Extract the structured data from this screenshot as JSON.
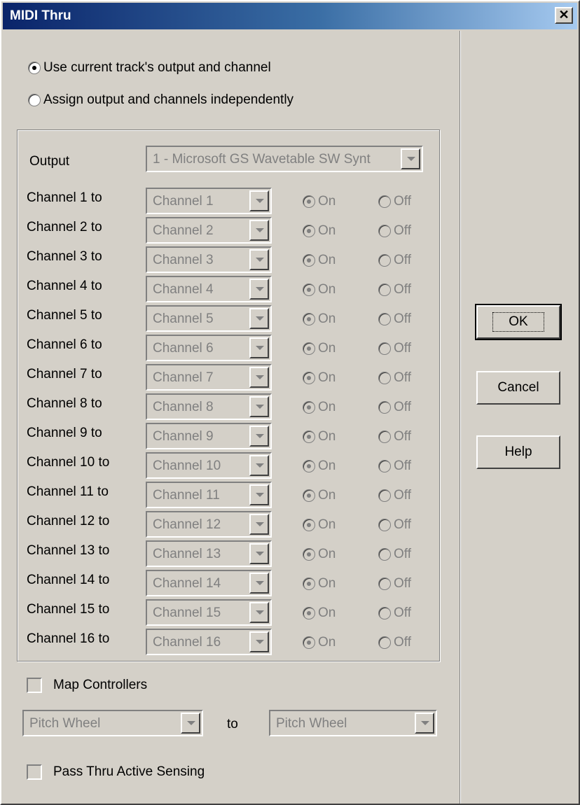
{
  "window": {
    "title": "MIDI Thru",
    "close_glyph": "✕"
  },
  "mode": {
    "options": [
      {
        "label": "Use current track's output and channel",
        "checked": true
      },
      {
        "label": "Assign output and channels independently",
        "checked": false
      }
    ]
  },
  "output": {
    "label": "Output",
    "value": "1 - Microsoft GS Wavetable SW Synt"
  },
  "channels": [
    {
      "label": "Channel 1 to",
      "value": "Channel 1",
      "on": "On",
      "off": "Off"
    },
    {
      "label": "Channel 2 to",
      "value": "Channel 2",
      "on": "On",
      "off": "Off"
    },
    {
      "label": "Channel 3 to",
      "value": "Channel 3",
      "on": "On",
      "off": "Off"
    },
    {
      "label": "Channel 4 to",
      "value": "Channel 4",
      "on": "On",
      "off": "Off"
    },
    {
      "label": "Channel 5 to",
      "value": "Channel 5",
      "on": "On",
      "off": "Off"
    },
    {
      "label": "Channel 6 to",
      "value": "Channel 6",
      "on": "On",
      "off": "Off"
    },
    {
      "label": "Channel 7 to",
      "value": "Channel 7",
      "on": "On",
      "off": "Off"
    },
    {
      "label": "Channel 8 to",
      "value": "Channel 8",
      "on": "On",
      "off": "Off"
    },
    {
      "label": "Channel 9 to",
      "value": "Channel 9",
      "on": "On",
      "off": "Off"
    },
    {
      "label": "Channel 10 to",
      "value": "Channel 10",
      "on": "On",
      "off": "Off"
    },
    {
      "label": "Channel 11 to",
      "value": "Channel 11",
      "on": "On",
      "off": "Off"
    },
    {
      "label": "Channel 12 to",
      "value": "Channel 12",
      "on": "On",
      "off": "Off"
    },
    {
      "label": "Channel 13 to",
      "value": "Channel 13",
      "on": "On",
      "off": "Off"
    },
    {
      "label": "Channel 14 to",
      "value": "Channel 14",
      "on": "On",
      "off": "Off"
    },
    {
      "label": "Channel 15 to",
      "value": "Channel 15",
      "on": "On",
      "off": "Off"
    },
    {
      "label": "Channel 16 to",
      "value": "Channel 16",
      "on": "On",
      "off": "Off"
    }
  ],
  "map_controllers": {
    "label": "Map Controllers",
    "checked": false
  },
  "controller_map": {
    "from_value": "Pitch Wheel",
    "to_label": "to",
    "to_value": "Pitch Wheel"
  },
  "active_sensing": {
    "label": "Pass Thru Active Sensing",
    "checked": false
  },
  "buttons": {
    "ok": "OK",
    "cancel": "Cancel",
    "help": "Help"
  },
  "colors": {
    "face": "#d4d0c8",
    "disabled_text": "#808080",
    "title_start": "#0a246a",
    "title_end": "#a6caf0"
  }
}
